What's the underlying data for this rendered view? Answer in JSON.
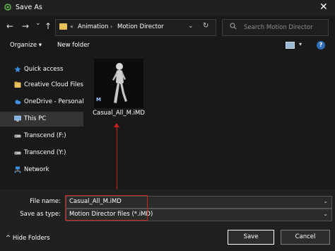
{
  "window": {
    "title": "Save As",
    "close_glyph": "✕"
  },
  "nav": {
    "back_glyph": "←",
    "forward_glyph": "→",
    "recent_glyph": "⌄",
    "up_glyph": "↑",
    "breadcrumb_overflow": "«",
    "breadcrumbs": [
      "Animation",
      "Motion Director"
    ],
    "breadcrumb_separator": "›",
    "dropdown_glyph": "⌄",
    "refresh_glyph": "↻",
    "search_placeholder": "Search Motion Director"
  },
  "commands": {
    "organize": "Organize ▾",
    "new_folder": "New folder",
    "view_dropdown": "▾",
    "help": "?"
  },
  "sidebar": {
    "items": [
      {
        "label": "Quick access",
        "icon": "star-icon",
        "color": "#3d8fe0"
      },
      {
        "label": "Creative Cloud Files",
        "icon": "creative-cloud-icon",
        "color": "#e8c15a"
      },
      {
        "label": "OneDrive - Personal",
        "icon": "cloud-icon",
        "color": "#3d8fe0"
      },
      {
        "label": "This PC",
        "icon": "computer-icon",
        "color": "#7fb3e6",
        "selected": true
      },
      {
        "label": "Transcend (F:)",
        "icon": "drive-icon",
        "color": "#bfbfbf"
      },
      {
        "label": "Transcend (Y:)",
        "icon": "drive-icon",
        "color": "#bfbfbf"
      },
      {
        "label": "Network",
        "icon": "network-icon",
        "color": "#3d8fe0"
      }
    ]
  },
  "files": [
    {
      "name": "Casual_All_M.iMD",
      "badge": "M",
      "icon": "3d-character-thumbnail"
    }
  ],
  "form": {
    "file_name_label": "File name:",
    "file_name_value": "Casual_All_M.iMD",
    "save_type_label": "Save as type:",
    "save_type_value": "Motion Director files (*.iMD)",
    "dropdown_glyph": "⌄"
  },
  "footer": {
    "hide_folders": "^  Hide Folders",
    "save": "Save",
    "cancel": "Cancel"
  },
  "colors": {
    "annotation": "#cc1f1f",
    "accent": "#3d8fe0"
  }
}
